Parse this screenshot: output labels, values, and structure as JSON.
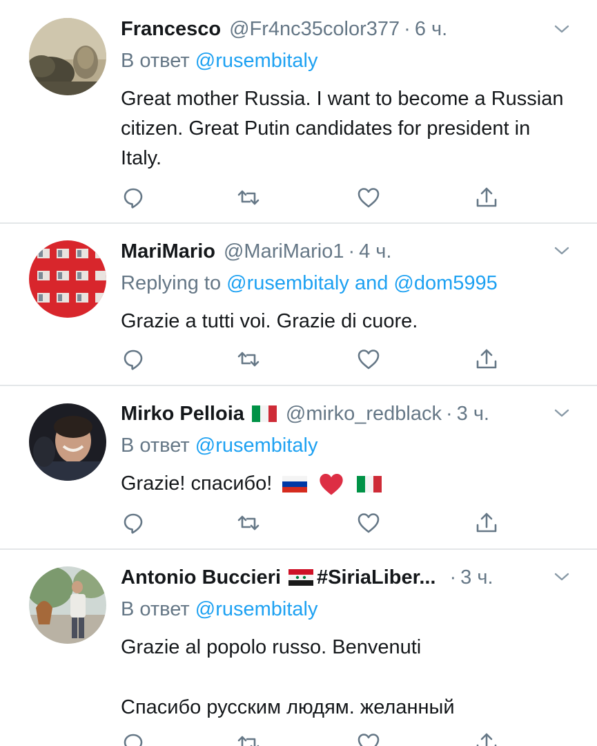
{
  "tweets": [
    {
      "name": "Francesco",
      "handle": "@Fr4nc35color377",
      "dot": "·",
      "time": "6 ч.",
      "reply_prefix": "В ответ",
      "reply_to": [
        "@rusembitaly"
      ],
      "reply_conj": "",
      "text": "Great mother Russia.  I want to become a Russian citizen.  Great Putin candidates for president in Italy."
    },
    {
      "name": "MariMario",
      "handle": "@MariMario1",
      "dot": "·",
      "time": "4 ч.",
      "reply_prefix": "Replying to",
      "reply_to": [
        "@rusembitaly",
        "@dom5995"
      ],
      "reply_conj": "and",
      "text": "Grazie a tutti voi. Grazie di cuore."
    },
    {
      "name": "Mirko Pelloia",
      "badge": "italian-flag",
      "handle": "@mirko_redblack",
      "dot": "·",
      "time": "3 ч.",
      "reply_prefix": "В ответ",
      "reply_to": [
        "@rusembitaly"
      ],
      "reply_conj": "",
      "text": "Grazie! спасибо!",
      "emojis": [
        "russian-flag",
        "red-heart",
        "italian-flag"
      ]
    },
    {
      "name": "Antonio Buccieri",
      "badge": "syrian-flag",
      "handle": "#SiriaLiber...",
      "dot": "·",
      "time": "3 ч.",
      "reply_prefix": "В ответ",
      "reply_to": [
        "@rusembitaly"
      ],
      "reply_conj": "",
      "text_line1": "Grazie al popolo russo. Benvenuti",
      "text_line2": "Спасибо русским людям.  желанный"
    }
  ],
  "colors": {
    "text": "#14171a",
    "secondary": "#657786",
    "link": "#1da1f2",
    "divider": "#e3e6e8"
  },
  "icons": [
    "reply-icon",
    "retweet-icon",
    "like-icon",
    "share-icon",
    "chevron-down-icon"
  ]
}
